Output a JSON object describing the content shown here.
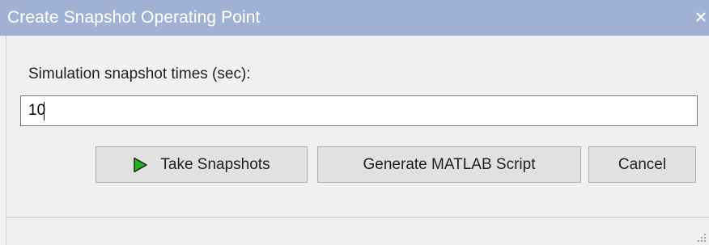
{
  "window": {
    "title": "Create Snapshot Operating Point",
    "close_icon": "close-icon"
  },
  "form": {
    "label": "Simulation snapshot times (sec):",
    "times_value": "10"
  },
  "buttons": {
    "take_snapshots": "Take Snapshots",
    "take_snapshots_icon": "play-icon",
    "generate_script": "Generate MATLAB Script",
    "cancel": "Cancel"
  },
  "colors": {
    "titlebar": "#9fb2d4",
    "play_icon_fill": "#21b221"
  }
}
